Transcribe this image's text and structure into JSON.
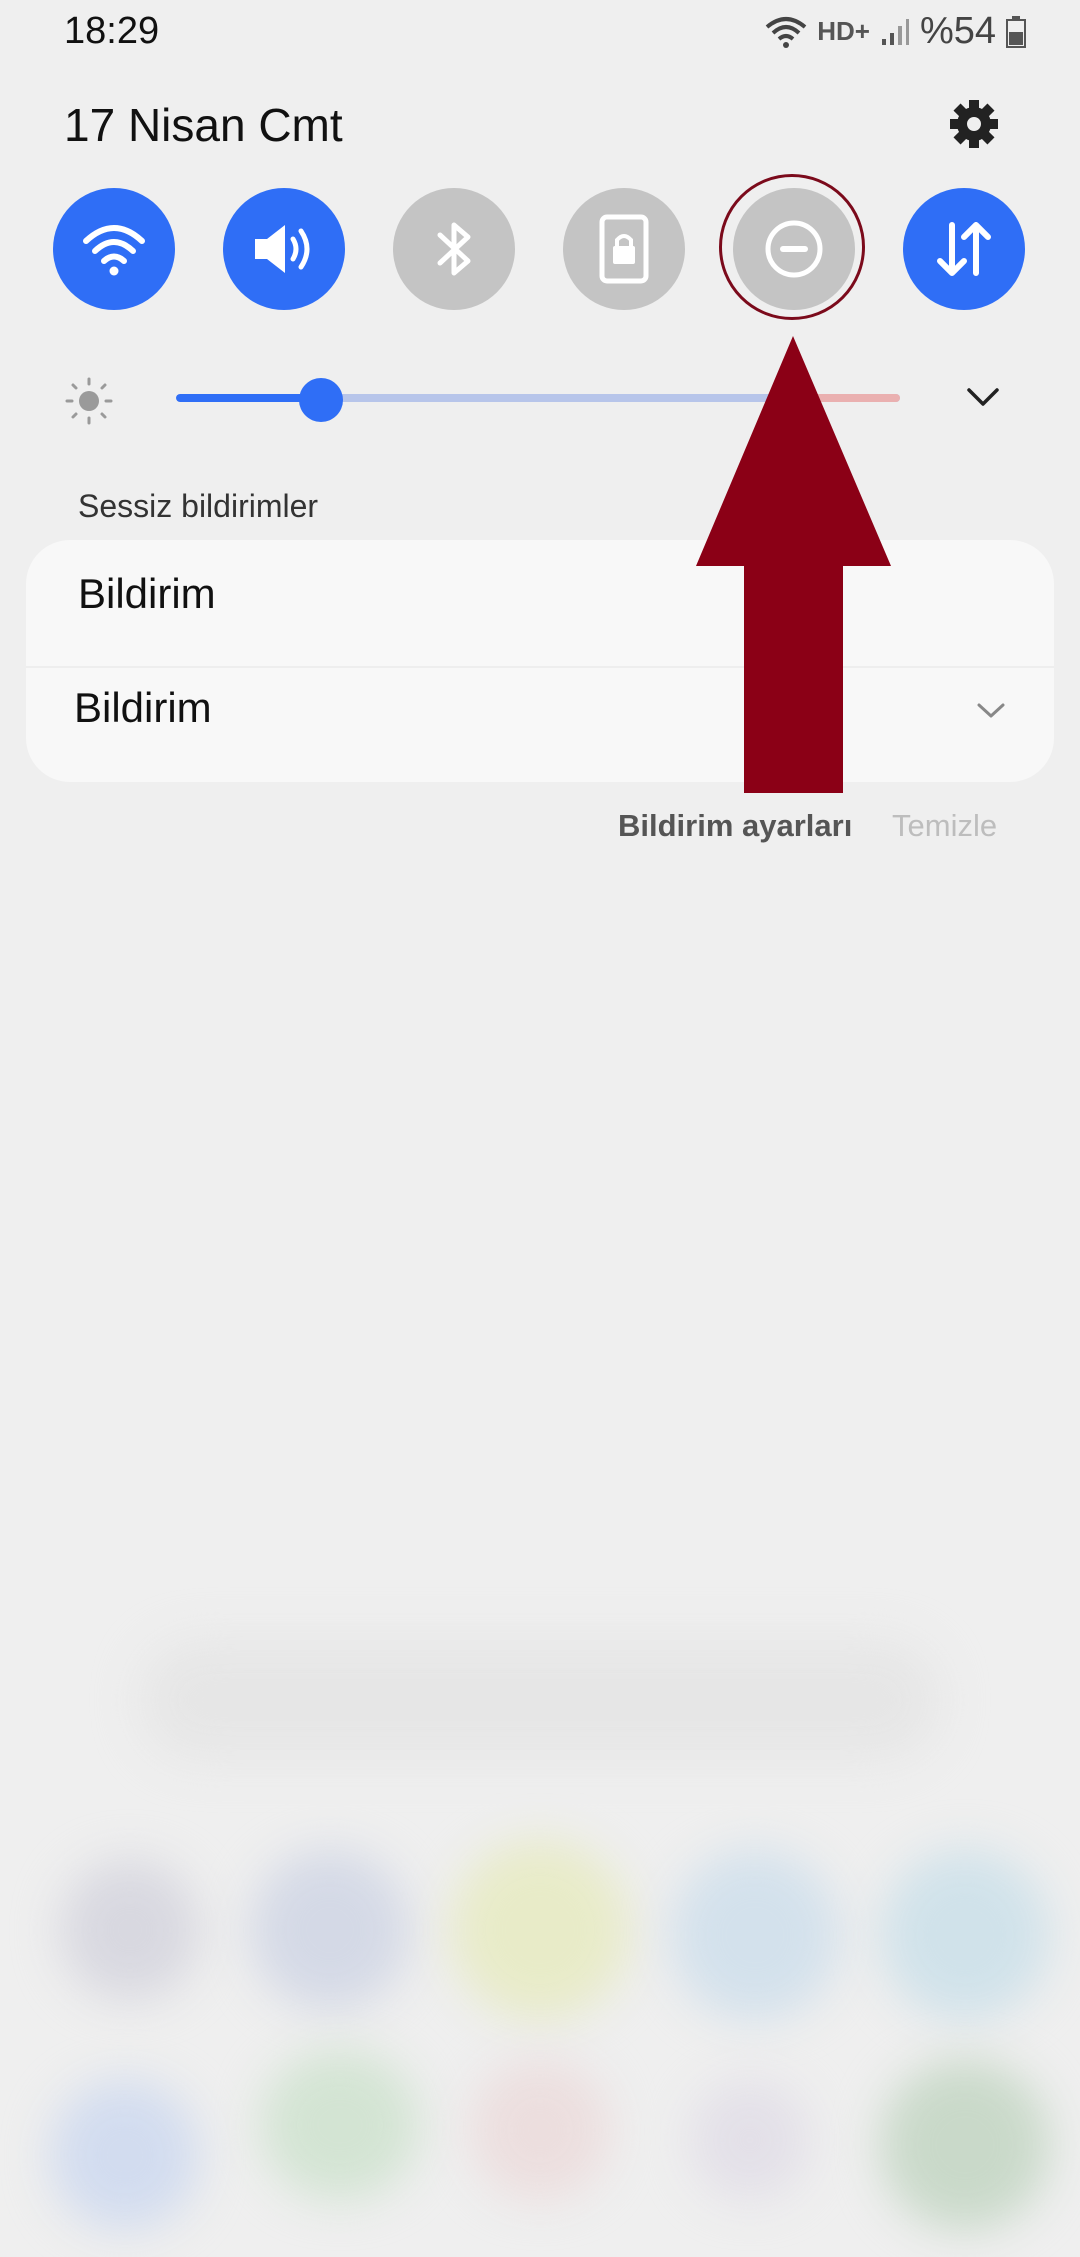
{
  "status": {
    "time": "18:29",
    "network_label": "HD+",
    "battery": "%54"
  },
  "header": {
    "date": "17 Nisan Cmt",
    "settings_icon": "gear-icon"
  },
  "quick_toggles": [
    {
      "name": "wifi",
      "icon": "wifi-icon",
      "active": true
    },
    {
      "name": "sound",
      "icon": "volume-icon",
      "active": true
    },
    {
      "name": "bluetooth",
      "icon": "bluetooth-icon",
      "active": false
    },
    {
      "name": "screen-lock",
      "icon": "rotation-lock-icon",
      "active": false
    },
    {
      "name": "do-not-disturb",
      "icon": "do-not-disturb-icon",
      "active": false,
      "highlighted": true
    },
    {
      "name": "mobile-data",
      "icon": "data-transfer-icon",
      "active": true
    }
  ],
  "brightness": {
    "level": 0.2,
    "icon": "sun-icon",
    "expand_icon": "chevron-down-icon"
  },
  "notifications": {
    "section_title": "Sessiz bildirimler",
    "items": [
      {
        "title": "Bildirim"
      },
      {
        "title": "Bildirim"
      }
    ],
    "settings_label": "Bildirim ayarları",
    "clear_label": "Temizle"
  },
  "colors": {
    "accent": "#2f6ef6",
    "inactive": "#c4c4c4",
    "annotation": "#8b0016"
  }
}
